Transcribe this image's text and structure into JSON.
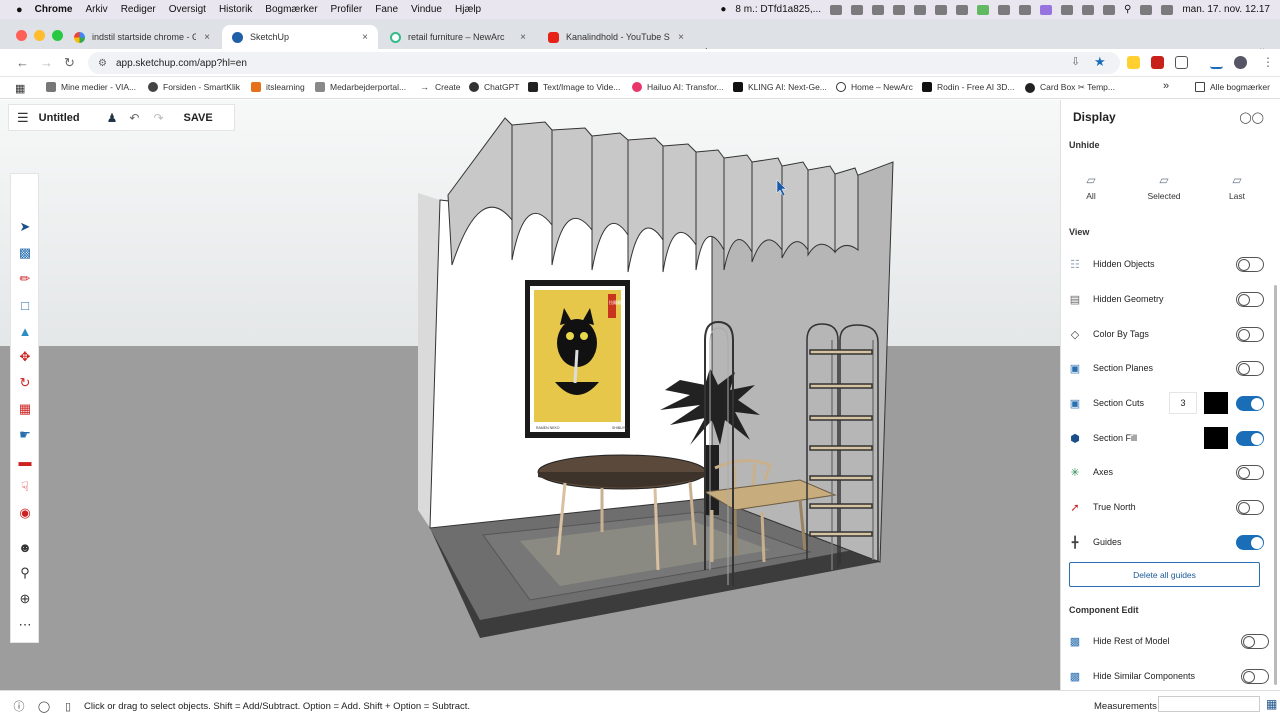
{
  "mac_menubar": {
    "items": [
      "Chrome",
      "Arkiv",
      "Rediger",
      "Oversigt",
      "Historik",
      "Bogmærker",
      "Profiler",
      "Fane",
      "Vindue",
      "Hjælp"
    ],
    "notification": "8 m.: DTfd1a825,...",
    "datetime": "man. 17. nov. 12.17"
  },
  "tabs": [
    {
      "title": "indstil startside chrome - Go",
      "close": "×"
    },
    {
      "title": "SketchUp",
      "close": "×"
    },
    {
      "title": "retail furniture – NewArc",
      "close": "×"
    },
    {
      "title": "Kanalindhold - YouTube Studi",
      "close": "×"
    }
  ],
  "new_tab": "+",
  "address": {
    "url": "app.sketchup.com/app?hl=en"
  },
  "bookmarks": {
    "items": [
      "Mine medier - VIA...",
      "Forsiden - SmartKlik",
      "itslearning",
      "Medarbejderportal...",
      "Create",
      "ChatGPT",
      "Text/Image to Vide...",
      "Hailuo AI: Transfor...",
      "KLING AI: Next-Ge...",
      "Home – NewArc",
      "Rodin - Free AI 3D...",
      "Card Box ✂ Temp..."
    ],
    "more": "»",
    "all": "Alle bogmærker"
  },
  "sketchup": {
    "title": "Untitled",
    "save": "SAVE"
  },
  "display_panel": {
    "title": "Display",
    "unhide_section": "Unhide",
    "unhide_buttons": [
      "All",
      "Selected",
      "Last"
    ],
    "view_section": "View",
    "view_items": [
      {
        "label": "Hidden Objects",
        "on": false
      },
      {
        "label": "Hidden Geometry",
        "on": false
      },
      {
        "label": "Color By Tags",
        "on": false
      },
      {
        "label": "Section Planes",
        "on": false
      },
      {
        "label": "Section Cuts",
        "on": true,
        "number": "3",
        "swatch": "#000000"
      },
      {
        "label": "Section Fill",
        "on": true,
        "swatch": "#000000"
      },
      {
        "label": "Axes",
        "on": false
      },
      {
        "label": "True North",
        "on": false
      },
      {
        "label": "Guides",
        "on": true
      }
    ],
    "delete_guides": "Delete all guides",
    "component_section": "Component Edit",
    "component_items": [
      {
        "label": "Hide Rest of Model",
        "on": false
      },
      {
        "label": "Hide Similar Components",
        "on": false
      }
    ]
  },
  "status": {
    "hint": "Click or drag to select objects. Shift = Add/Subtract. Option = Add. Shift + Option = Subtract.",
    "measurements_label": "Measurements"
  },
  "poster_text": {
    "caption_left": "RAMEN NEKO",
    "caption_right": "SHIBUYA",
    "seal": "拉麺猫"
  },
  "colors": {
    "accent": "#1a6eb8",
    "ground": "#9a9a9a",
    "sky": "#eef0f1"
  }
}
